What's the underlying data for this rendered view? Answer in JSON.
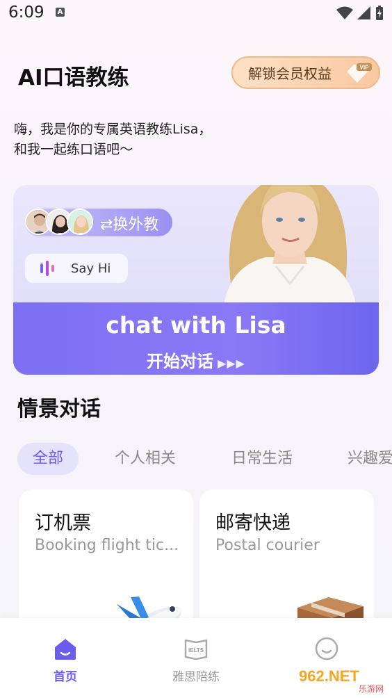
{
  "status_bar": {
    "time": "6:09",
    "notification_icon": "A"
  },
  "header": {
    "title": "AI口语教练",
    "vip_label": "解锁会员权益",
    "vip_badge": "VIP"
  },
  "greeting": {
    "line1": "嗨，我是你的专属英语教练Lisa，",
    "line2": "和我一起练口语吧～"
  },
  "hero": {
    "switch_label": "⇄换外教",
    "say_hi": "Say Hi",
    "title": "chat with Lisa",
    "subtitle": "开始对话",
    "arrows": "▶▶▶"
  },
  "scenes": {
    "title": "情景对话",
    "tabs": [
      {
        "label": "全部",
        "active": true
      },
      {
        "label": "个人相关",
        "active": false
      },
      {
        "label": "日常生活",
        "active": false
      },
      {
        "label": "兴趣爱好",
        "active": false
      }
    ],
    "cards": [
      {
        "title": "订机票",
        "subtitle": "Booking flight tic...",
        "icon": "airplane-icon"
      },
      {
        "title": "邮寄快递",
        "subtitle": "Postal courier",
        "icon": "package-icon"
      }
    ]
  },
  "nav": {
    "items": [
      {
        "label": "首页",
        "icon": "home-icon",
        "active": true
      },
      {
        "label": "雅思陪练",
        "icon": "ielts-book-icon",
        "icon_text": "IELTS",
        "active": false
      },
      {
        "label": "",
        "icon": "profile-icon",
        "active": false
      }
    ]
  },
  "watermark": {
    "text": "962.NET",
    "sub": "乐游网"
  },
  "colors": {
    "accent": "#6b5cf0",
    "vip_bg": "#f9c8a0",
    "hero_band": "#7c6ff3"
  }
}
